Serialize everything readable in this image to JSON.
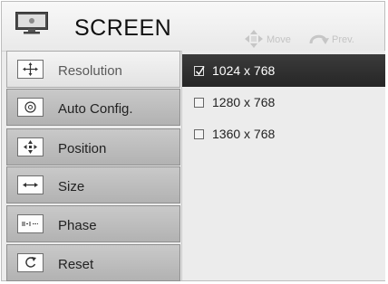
{
  "header": {
    "title": "SCREEN",
    "icon": "monitor-icon",
    "hints": [
      {
        "icon": "four-way-arrow-icon",
        "label": "Move"
      },
      {
        "icon": "return-arrow-icon",
        "label": "Prev."
      }
    ]
  },
  "sidebar": {
    "items": [
      {
        "label": "Resolution",
        "icon": "resolution-icon",
        "active": true
      },
      {
        "label": "Auto Config.",
        "icon": "auto-config-icon",
        "active": false
      },
      {
        "label": "Position",
        "icon": "position-icon",
        "active": false
      },
      {
        "label": "Size",
        "icon": "size-icon",
        "active": false
      },
      {
        "label": "Phase",
        "icon": "phase-icon",
        "active": false
      },
      {
        "label": "Reset",
        "icon": "reset-icon",
        "active": false
      }
    ]
  },
  "resolution_options": [
    {
      "label": "1024 x 768",
      "checked": true
    },
    {
      "label": "1280 x 768",
      "checked": false
    },
    {
      "label": "1360 x 768",
      "checked": false
    }
  ],
  "colors": {
    "selected_row": "#2f2f2f",
    "menu_item": "#bdbdbd",
    "active_menu_item": "#efefef",
    "panel": "#ececec"
  }
}
